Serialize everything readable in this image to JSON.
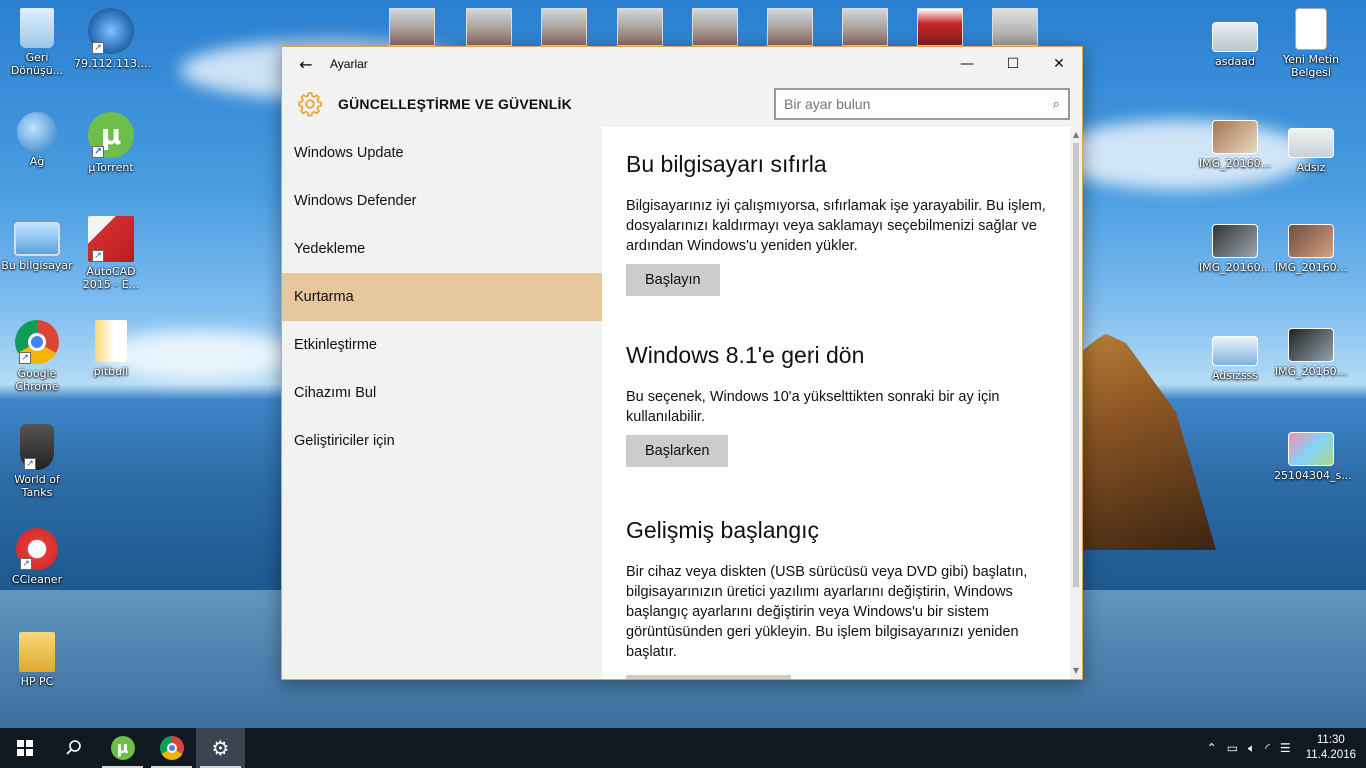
{
  "desktop": {
    "left_icons": [
      {
        "label": "Geri Dönüşü...",
        "icon": "recycle-bin-icon"
      },
      {
        "label": "79.112.113....",
        "icon": "teamspeak-icon"
      },
      {
        "label": "Ağ",
        "icon": "network-icon"
      },
      {
        "label": "µTorrent",
        "icon": "utorrent-icon"
      },
      {
        "label": "Bu bilgisayar",
        "icon": "computer-icon"
      },
      {
        "label": "AutoCAD 2015 - E...",
        "icon": "autocad-icon"
      },
      {
        "label": "Google Chrome",
        "icon": "chrome-icon"
      },
      {
        "label": "pitbull",
        "icon": "document-icon"
      },
      {
        "label": "World of Tanks",
        "icon": "world-of-tanks-icon"
      },
      {
        "label": "CCleaner",
        "icon": "ccleaner-icon"
      },
      {
        "label": "HP PC",
        "icon": "user-folder-icon"
      }
    ],
    "right_icons": [
      {
        "label": "asdaad"
      },
      {
        "label": "Yeni Metin Belgesi"
      },
      {
        "label": "IMG_20160..."
      },
      {
        "label": "Adsız"
      },
      {
        "label": "IMG_20160..."
      },
      {
        "label": "IMG_20160..."
      },
      {
        "label": "Adsızsss"
      },
      {
        "label": "IMG_20160..."
      },
      {
        "label": "25104304_s..."
      }
    ]
  },
  "window": {
    "title": "Ayarlar",
    "back_glyph": "←",
    "minimize_glyph": "—",
    "maximize_glyph": "☐",
    "close_glyph": "✕",
    "section_title": "GÜNCELLEŞTİRME VE GÜVENLİK",
    "search_placeholder": "Bir ayar bulun",
    "nav_items": [
      "Windows Update",
      "Windows Defender",
      "Yedekleme",
      "Kurtarma",
      "Etkinleştirme",
      "Cihazımı Bul",
      "Geliştiriciler için"
    ],
    "active_nav": "Kurtarma",
    "sections": [
      {
        "heading": "Bu bilgisayarı sıfırla",
        "text": "Bilgisayarınız iyi çalışmıyorsa, sıfırlamak işe yarayabilir. Bu işlem, dosyalarınızı kaldırmayı veya saklamayı seçebilmenizi sağlar ve ardından Windows'u yeniden yükler.",
        "button": "Başlayın"
      },
      {
        "heading": "Windows 8.1'e geri dön",
        "text": "Bu seçenek, Windows 10'a yükselttikten sonraki bir ay için kullanılabilir.",
        "button": "Başlarken"
      },
      {
        "heading": "Gelişmiş başlangıç",
        "text": "Bir cihaz veya diskten (USB sürücüsü veya DVD gibi) başlatın, bilgisayarınızın üretici yazılımı ayarlarını değiştirin, Windows başlangıç ayarlarını değiştirin veya Windows'u bir sistem görüntüsünden geri yükleyin. Bu işlem bilgisayarınızı yeniden başlatır."
      }
    ]
  },
  "taskbar": {
    "time": "11:30",
    "date": "11.4.2016"
  },
  "colors": {
    "active_nav_bg": "#e6c79c",
    "accent_gear": "#e8a33d",
    "taskbar_bg": "#101820"
  }
}
